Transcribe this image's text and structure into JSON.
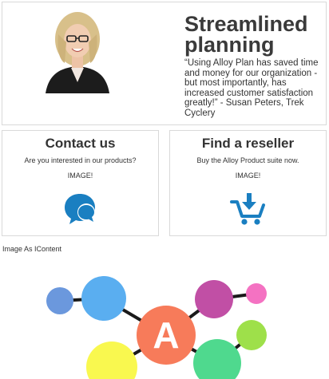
{
  "hero": {
    "title": "Streamlined planning",
    "quote": "“Using Alloy Plan has saved time and money for our organization - but most importantly, has increased customer satisfaction greatly!” - Susan Peters, Trek Cyclery"
  },
  "cards": {
    "contact": {
      "title": "Contact us",
      "text": "Are you interested in our products?",
      "image_text": "IMAGE!",
      "icon": "chat-bubbles-icon",
      "color": "#1a7fc1"
    },
    "reseller": {
      "title": "Find a reseller",
      "text": "Buy the Alloy Product suite now.",
      "image_text": "IMAGE!",
      "icon": "cart-download-icon",
      "color": "#1a7fc1"
    }
  },
  "image_content": {
    "label": "Image As IContent",
    "center_letter": "A",
    "colors": {
      "center": "#f77b5a",
      "blue_small": "#6b98dd",
      "blue": "#5aaef0",
      "purple": "#c14fa5",
      "pink": "#f472c2",
      "green_light": "#9ee04a",
      "yellow": "#f9f84f",
      "green": "#4fd98e",
      "line": "#1a1a1a"
    }
  }
}
